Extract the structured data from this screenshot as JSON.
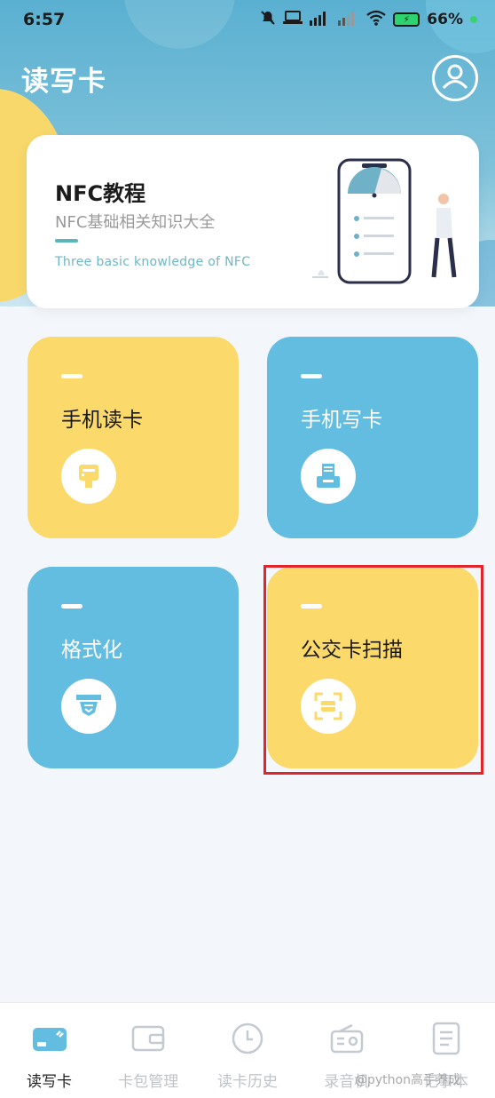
{
  "status_bar": {
    "time": "6:57",
    "battery": "66%"
  },
  "header": {
    "title": "读写卡",
    "avatar_icon": "user-circle-icon"
  },
  "tutorial": {
    "title": "NFC教程",
    "subtitle": "NFC基础相关知识大全",
    "english": "Three basic knowledge of NFC"
  },
  "tiles": [
    {
      "label": "手机读卡",
      "color": "#fbd96b",
      "icon": "card-reader-icon"
    },
    {
      "label": "手机写卡",
      "color": "#62bde1",
      "icon": "card-writer-icon"
    },
    {
      "label": "格式化",
      "color": "#62bde1",
      "icon": "format-icon"
    },
    {
      "label": "公交卡扫描",
      "color": "#fbd96b",
      "icon": "scan-icon"
    }
  ],
  "bottom_nav": [
    {
      "label": "读写卡",
      "icon": "card-icon",
      "active": true
    },
    {
      "label": "卡包管理",
      "icon": "wallet-icon",
      "active": false
    },
    {
      "label": "读卡历史",
      "icon": "clock-icon",
      "active": false
    },
    {
      "label": "录音机",
      "icon": "radio-icon",
      "active": false
    },
    {
      "label": "记事本",
      "icon": "notepad-icon",
      "active": false
    }
  ],
  "watermark": "@python高手养成",
  "colors": {
    "header_blue": "#5ab0d1",
    "tile_yellow": "#fbd96b",
    "tile_blue": "#62bde1",
    "highlight_red": "#e3242b",
    "teal_accent": "#5ab7b8"
  }
}
